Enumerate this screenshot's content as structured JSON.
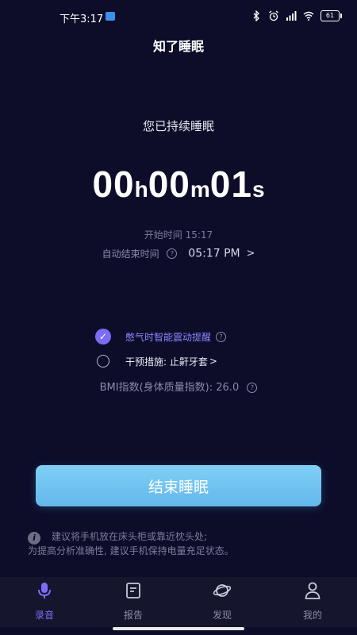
{
  "status_bar": {
    "time": "下午3:17",
    "battery": "61"
  },
  "app": {
    "title": "知了睡眠"
  },
  "sleep": {
    "label": "您已持续睡眠",
    "hours": "00",
    "hours_unit": "h",
    "minutes": "00",
    "minutes_unit": "m",
    "seconds": "01",
    "seconds_unit": "s",
    "start_time": "开始时间 15:17",
    "auto_end_label": "自动结束时间",
    "auto_end_value": "05:17 PM",
    "auto_end_arrow": ">"
  },
  "options": {
    "vibration_label": "憋气时智能震动提醒",
    "vibration_checked": true,
    "intervention_label": "干预措施: 止鼾牙套",
    "intervention_arrow": ">",
    "intervention_checked": false,
    "bmi": "BMI指数(身体质量指数): 26.0"
  },
  "actions": {
    "end_button": "结束睡眠"
  },
  "tip": {
    "line1": "建议将手机放在床头柜或靠近枕头处;",
    "line2": "为提高分析准确性, 建议手机保持电量充足状态。"
  },
  "tabs": [
    {
      "label": "录音",
      "icon": "microphone-icon",
      "active": true
    },
    {
      "label": "报告",
      "icon": "report-icon",
      "active": false
    },
    {
      "label": "发现",
      "icon": "planet-icon",
      "active": false
    },
    {
      "label": "我的",
      "icon": "person-icon",
      "active": false
    }
  ],
  "colors": {
    "background": "#0d0d2a",
    "accent": "#7b6cf6",
    "button": "#6cc3f0"
  }
}
